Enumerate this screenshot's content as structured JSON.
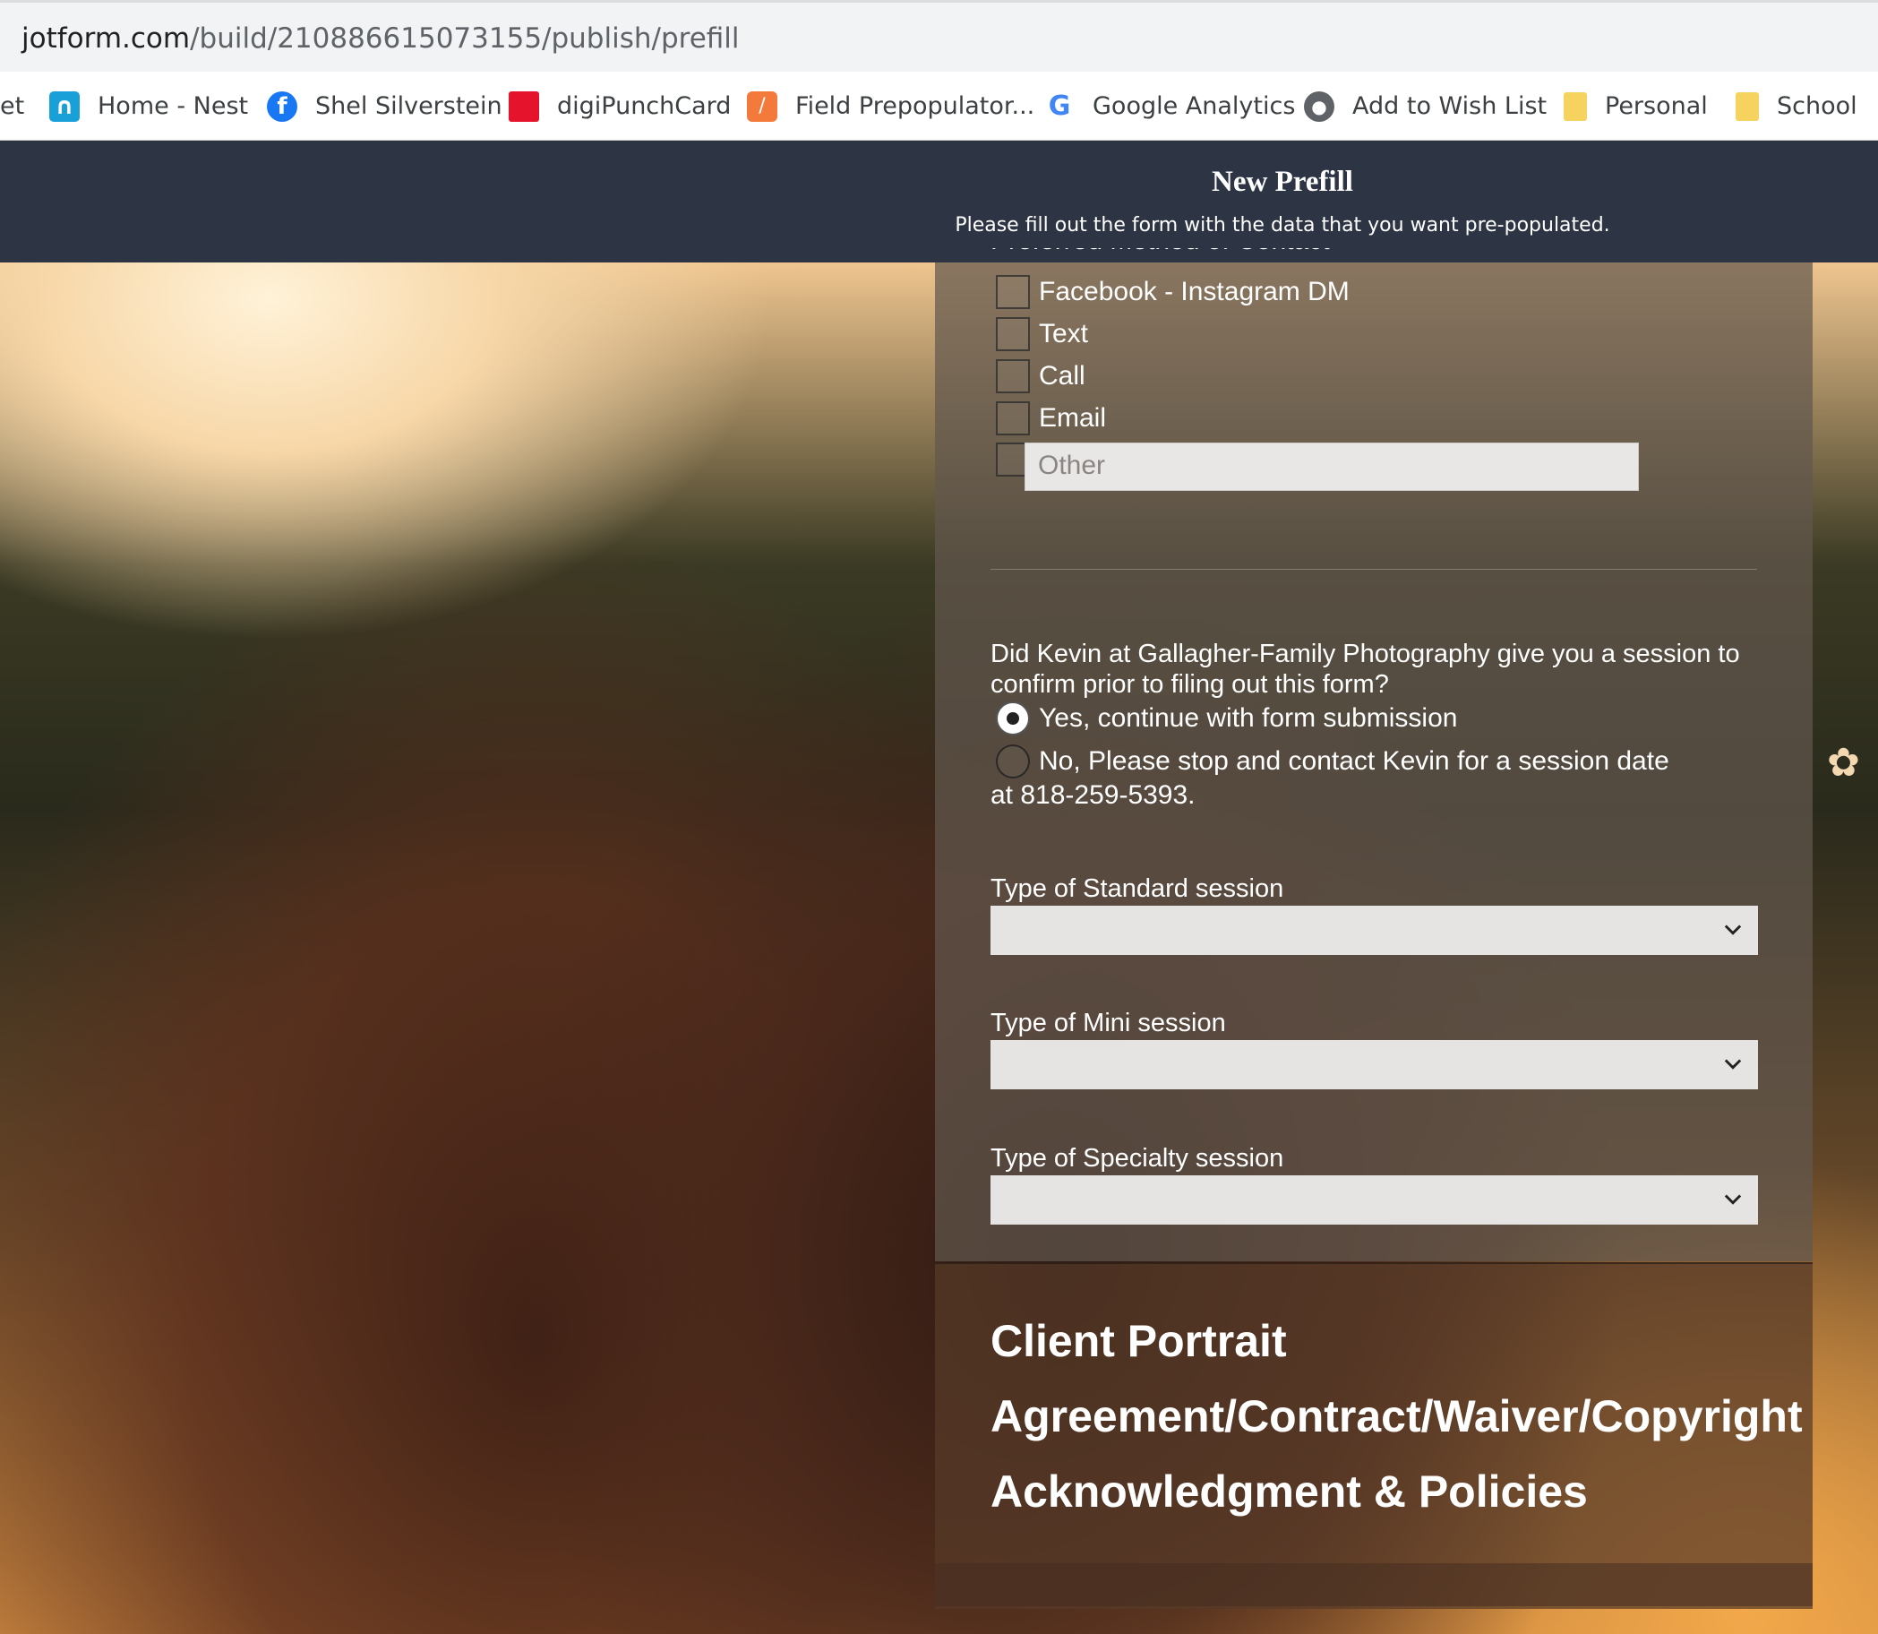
{
  "browser": {
    "url_host": "jotform.com",
    "url_path": "/build/210886615073155/publish/prefill",
    "bookmarks": [
      {
        "label": "et",
        "icon": "cut-off"
      },
      {
        "label": "Home - Nest",
        "icon": "nest-icon"
      },
      {
        "label": "Shel Silverstein",
        "icon": "facebook-icon"
      },
      {
        "label": "digiPunchCard",
        "icon": "punchcard-icon"
      },
      {
        "label": "Field Prepopulator...",
        "icon": "prepopulator-icon"
      },
      {
        "label": "Google Analytics",
        "icon": "google-icon"
      },
      {
        "label": "Add to Wish List",
        "icon": "globe-icon"
      },
      {
        "label": "Personal",
        "icon": "folder-icon"
      },
      {
        "label": "School",
        "icon": "folder-icon"
      }
    ]
  },
  "header": {
    "title": "New Prefill",
    "subtitle": "Please fill out the form with the data that you want pre-populated."
  },
  "form": {
    "contact_label": "Preferred Method of Contact",
    "contact_options": [
      "Facebook - Instagram DM",
      "Text",
      "Call",
      "Email"
    ],
    "other_placeholder": "Other",
    "question": "Did Kevin at Gallagher-Family Photography give you a session to confirm prior to filing out this form?",
    "radio_options": [
      {
        "label": "Yes, continue with form submission",
        "checked": true
      },
      {
        "label": "No, Please stop and contact Kevin for a session date",
        "checked": false
      }
    ],
    "radio_continuation": "at 818-259-5393.",
    "standard_label": "Type of Standard session",
    "mini_label": "Type of Mini session",
    "specialty_label": "Type of Specialty session",
    "standard_value": "",
    "mini_value": "",
    "specialty_value": "",
    "section_title_lines": [
      "Client Portrait",
      "Agreement/Contract/Waiver/Copyright",
      "Acknowledgment & Policies"
    ]
  },
  "colors": {
    "header_bg": "#2d3444",
    "panel_bg": "#62584e",
    "select_bg": "#e6e4e3"
  }
}
